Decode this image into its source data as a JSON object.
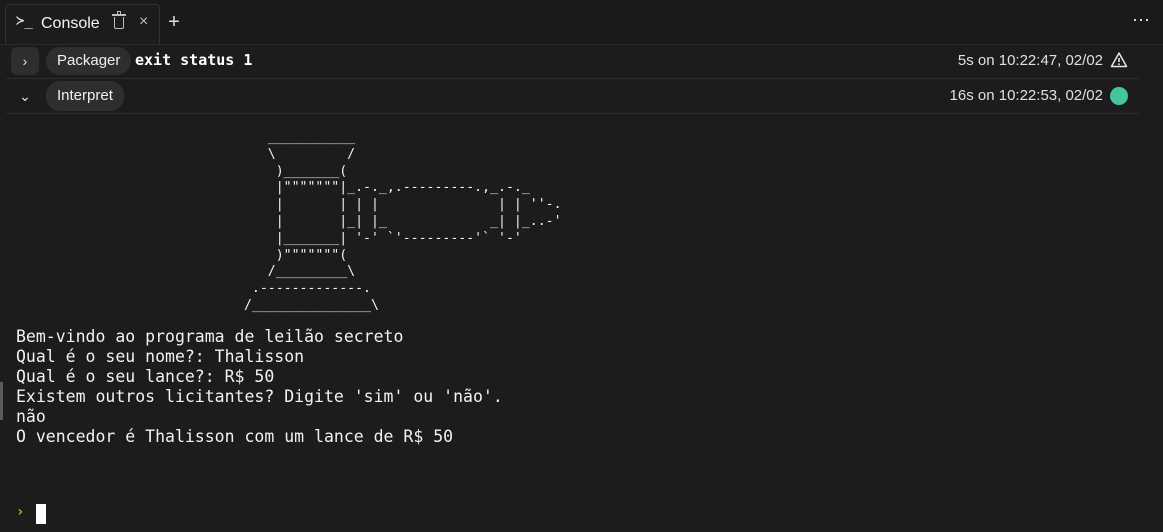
{
  "tab": {
    "icon": "terminal-icon",
    "glyph": "≻_",
    "title": "Console",
    "close": "×",
    "add": "+",
    "more": "⋯"
  },
  "runs": [
    {
      "expand_glyph": "›",
      "label": "Packager",
      "status": "exit status 1",
      "timing": "5s on 10:22:47, 02/02",
      "status_icon": "warning-icon"
    },
    {
      "expand_glyph": "⌄",
      "label": "Interpret",
      "timing": "16s on 10:22:53, 02/02",
      "status_icon": "success-dot-icon",
      "status_color": "#46c3a0"
    }
  ],
  "console": {
    "ascii_art": "    ___________\n    \\         /\n     )_______(\n     |\"\"\"\"\"\"\"|_.-._,.---------.,_.-._\n     |       | | |               | | ''-.\n     |       |_| |_             _| |_..-'\n     |_______| '-' `'---------'` '-'\n     )\"\"\"\"\"\"\"(\n    /_________\\\n  .-------------.\n /_______________\\",
    "lines": [
      "Bem-vindo ao programa de leilão secreto",
      "Qual é o seu nome?: Thalisson",
      "Qual é o seu lance?: R$ 50",
      "Existem outros licitantes? Digite 'sim' ou 'não'.",
      "não",
      "O vencedor é Thalisson com um lance de R$ 50"
    ],
    "prompt": "›",
    "prompt_color": "#e5a91e"
  }
}
